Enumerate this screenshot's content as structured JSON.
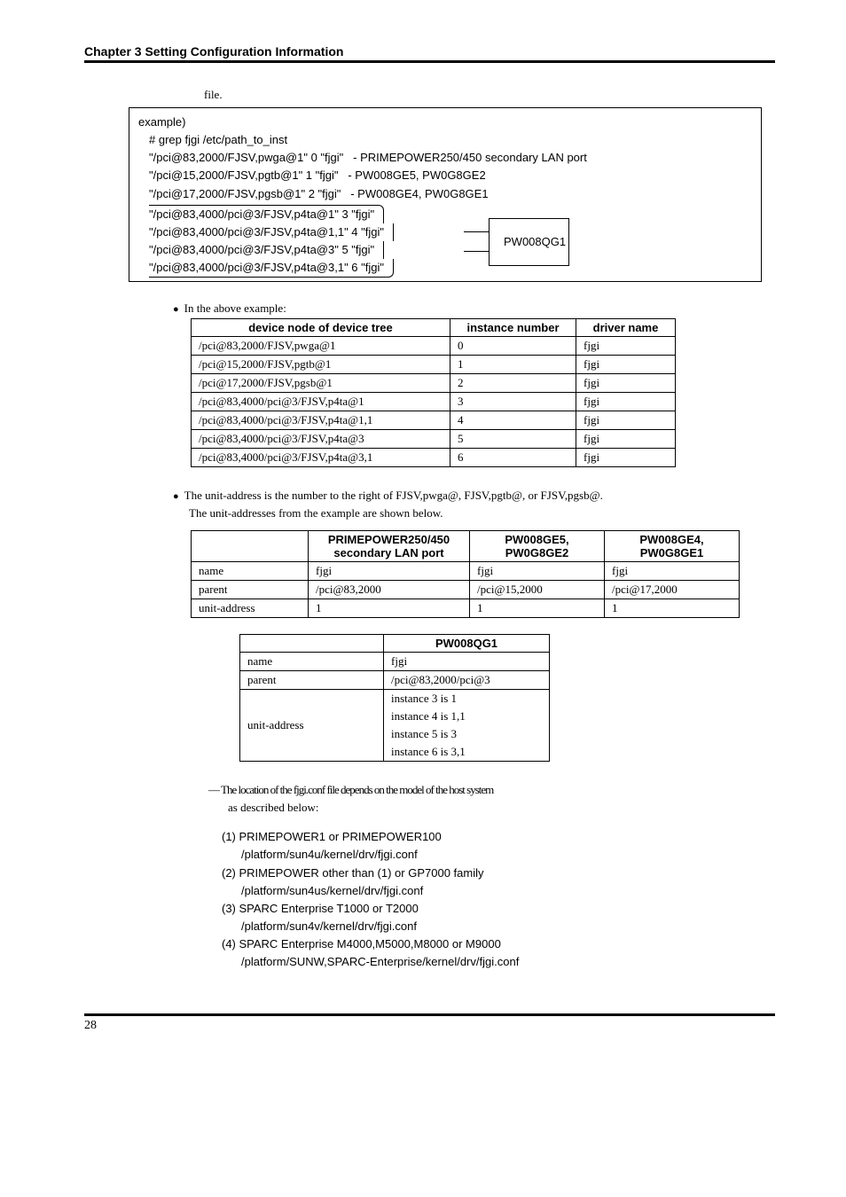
{
  "chapter_title": "Chapter 3 Setting Configuration Information",
  "file_caption": "file.",
  "example": {
    "title": "example)",
    "grep": "# grep fjgi /etc/path_to_inst",
    "rows": [
      {
        "left": "\"/pci@83,2000/FJSV,pwga@1\" 0 \"fjgi\"",
        "right": "- PRIMEPOWER250/450 secondary LAN port"
      },
      {
        "left": "\"/pci@15,2000/FJSV,pgtb@1\" 1 \"fjgi\"",
        "right": "- PW008GE5, PW0G8GE2"
      },
      {
        "left": "\"/pci@17,2000/FJSV,pgsb@1\" 2 \"fjgi\"",
        "right": "- PW008GE4, PW0G8GE1"
      }
    ],
    "bracket_rows": [
      "\"/pci@83,4000/pci@3/FJSV,p4ta@1\" 3 \"fjgi\"",
      "\"/pci@83,4000/pci@3/FJSV,p4ta@1,1\" 4 \"fjgi\"",
      "\"/pci@83,4000/pci@3/FJSV,p4ta@3\" 5 \"fjgi\"",
      "\"/pci@83,4000/pci@3/FJSV,p4ta@3,1\" 6 \"fjgi\""
    ],
    "bracket_label": "PW008QG1"
  },
  "above_example_label": "In the above example:",
  "tree_table": {
    "headers": [
      "device node of device tree",
      "instance number",
      "driver name"
    ],
    "rows": [
      [
        "/pci@83,2000/FJSV,pwga@1",
        "0",
        "fjgi"
      ],
      [
        "/pci@15,2000/FJSV,pgtb@1",
        "1",
        "fjgi"
      ],
      [
        "/pci@17,2000/FJSV,pgsb@1",
        "2",
        "fjgi"
      ],
      [
        "/pci@83,4000/pci@3/FJSV,p4ta@1",
        "3",
        "fjgi"
      ],
      [
        "/pci@83,4000/pci@3/FJSV,p4ta@1,1",
        "4",
        "fjgi"
      ],
      [
        "/pci@83,4000/pci@3/FJSV,p4ta@3",
        "5",
        "fjgi"
      ],
      [
        "/pci@83,4000/pci@3/FJSV,p4ta@3,1",
        "6",
        "fjgi"
      ]
    ]
  },
  "unit_para_1": "The unit-address is the number to the right of FJSV,pwga@, FJSV,pgtb@, or FJSV,pgsb@.",
  "unit_para_2": "The unit-addresses from the example are shown below.",
  "feat_table": {
    "headers": [
      "",
      "PRIMEPOWER250/450\nsecondary LAN port",
      "PW008GE5,\nPW0G8GE2",
      "PW008GE4,\nPW0G8GE1"
    ],
    "rows": [
      [
        "name",
        "fjgi",
        "fjgi",
        "fjgi"
      ],
      [
        "parent",
        "/pci@83,2000",
        "/pci@15,2000",
        "/pci@17,2000"
      ],
      [
        "unit-address",
        "1",
        "1",
        "1"
      ]
    ]
  },
  "qg_table": {
    "header": "PW008QG1",
    "rows_simple": [
      [
        "name",
        "fjgi"
      ],
      [
        "parent",
        "/pci@83,2000/pci@3"
      ]
    ],
    "ua_label": "unit-address",
    "ua_rows": [
      "instance 3 is 1",
      "instance 4 is 1,1",
      "instance 5 is 3",
      "instance 6 is 3,1"
    ]
  },
  "note_line1": "― The location of the fjgi.conf file depends on the model of the host system",
  "note_line2": "as described below:",
  "confs": [
    {
      "h": "(1) PRIMEPOWER1 or PRIMEPOWER100",
      "p": "/platform/sun4u/kernel/drv/fjgi.conf"
    },
    {
      "h": "(2) PRIMEPOWER other than (1) or GP7000 family",
      "p": "/platform/sun4us/kernel/drv/fjgi.conf"
    },
    {
      "h": "(3) SPARC Enterprise T1000 or T2000",
      "p": "/platform/sun4v/kernel/drv/fjgi.conf"
    },
    {
      "h": "(4) SPARC Enterprise M4000,M5000,M8000 or M9000",
      "p": "/platform/SUNW,SPARC-Enterprise/kernel/drv/fjgi.conf"
    }
  ],
  "page_number": "28"
}
